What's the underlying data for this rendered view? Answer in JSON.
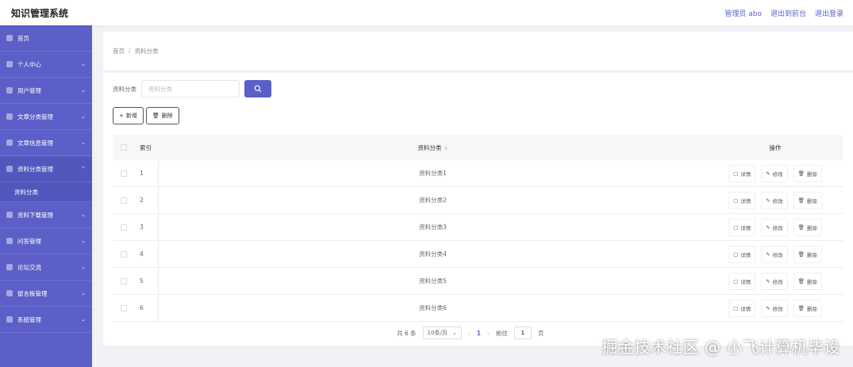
{
  "header": {
    "title": "知识管理系统",
    "admin_label": "管理员 abo",
    "to_frontend": "退出到前台",
    "logout": "退出登录"
  },
  "sidebar": {
    "items": [
      {
        "label": "首页",
        "icon": "home-icon",
        "chevron": ""
      },
      {
        "label": "个人中心",
        "icon": "user-icon",
        "chevron": "⌄"
      },
      {
        "label": "用户管理",
        "icon": "users-icon",
        "chevron": "⌄"
      },
      {
        "label": "文章分类管理",
        "icon": "folder-icon",
        "chevron": "⌄"
      },
      {
        "label": "文章信息管理",
        "icon": "article-icon",
        "chevron": "⌄"
      },
      {
        "label": "资料分类管理",
        "icon": "category-icon",
        "chevron": "⌃",
        "open": true,
        "sub": [
          "资料分类"
        ]
      },
      {
        "label": "资料下载管理",
        "icon": "download-icon",
        "chevron": "⌄"
      },
      {
        "label": "问答管理",
        "icon": "qa-icon",
        "chevron": "⌄"
      },
      {
        "label": "论坛交流",
        "icon": "forum-icon",
        "chevron": "⌄"
      },
      {
        "label": "留言板管理",
        "icon": "message-icon",
        "chevron": "⌄"
      },
      {
        "label": "系统管理",
        "icon": "settings-icon",
        "chevron": "⌄"
      }
    ]
  },
  "breadcrumb": {
    "home": "首页",
    "sep": "/",
    "current": "资料分类"
  },
  "search": {
    "label": "资料分类",
    "placeholder": "资料分类"
  },
  "actions": {
    "add": "新增",
    "delete": "删除"
  },
  "table": {
    "headers": {
      "index": "索引",
      "category": "资料分类",
      "ops": "操作"
    },
    "rows": [
      {
        "index": "1",
        "category": "资料分类1"
      },
      {
        "index": "2",
        "category": "资料分类2"
      },
      {
        "index": "3",
        "category": "资料分类3"
      },
      {
        "index": "4",
        "category": "资料分类4"
      },
      {
        "index": "5",
        "category": "资料分类5"
      },
      {
        "index": "6",
        "category": "资料分类6"
      }
    ],
    "op_labels": {
      "detail": "详情",
      "edit": "修改",
      "delete": "删除"
    }
  },
  "pagination": {
    "total": "共 6 条",
    "page_size": "10条/页",
    "current_page": "1",
    "goto_label": "前往",
    "goto_value": "1",
    "goto_suffix": "页"
  },
  "watermark": "掘金技术社区 @ 小飞计算机毕设",
  "colors": {
    "accent": "#5b5fc7"
  }
}
